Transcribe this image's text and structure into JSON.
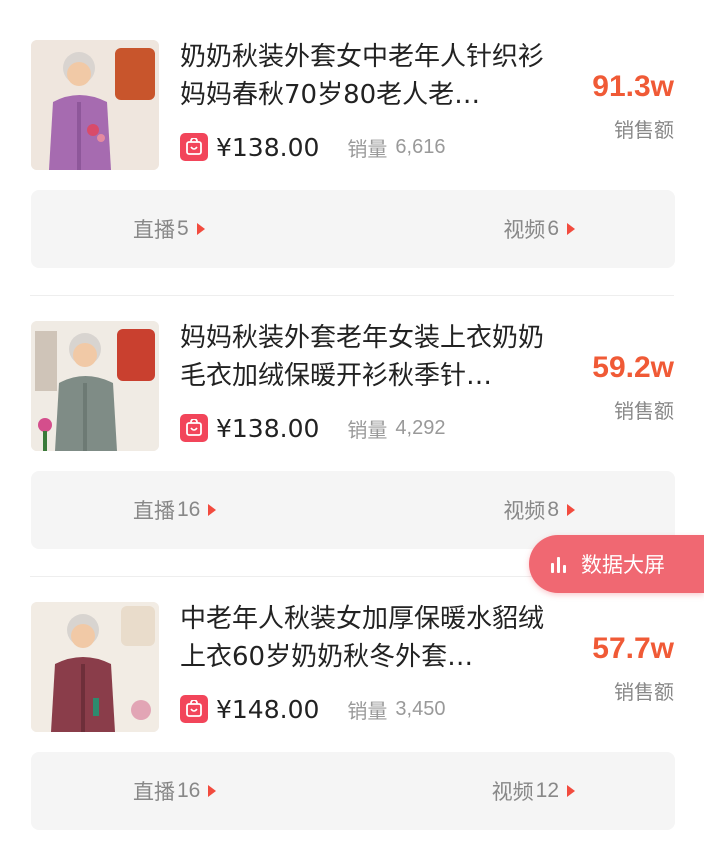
{
  "products": [
    {
      "title": "奶奶秋装外套女中老年人针织衫妈妈春秋70岁80老人老…",
      "price": "¥138.00",
      "sales_label": "销量",
      "sales_value": "6,616",
      "revenue": "91.3w",
      "revenue_label": "销售额",
      "live_label": "直播",
      "live_count": "5",
      "video_label": "视频",
      "video_count": "6",
      "cardigan_color": "#a66bb0"
    },
    {
      "title": "妈妈秋装外套老年女装上衣奶奶毛衣加绒保暖开衫秋季针…",
      "price": "¥138.00",
      "sales_label": "销量",
      "sales_value": "4,292",
      "revenue": "59.2w",
      "revenue_label": "销售额",
      "live_label": "直播",
      "live_count": "16",
      "video_label": "视频",
      "video_count": "8",
      "cardigan_color": "#7f8c86"
    },
    {
      "title": "中老年人秋装女加厚保暖水貂绒上衣60岁奶奶秋冬外套…",
      "price": "¥148.00",
      "sales_label": "销量",
      "sales_value": "3,450",
      "revenue": "57.7w",
      "revenue_label": "销售额",
      "live_label": "直播",
      "live_count": "16",
      "video_label": "视频",
      "video_count": "12",
      "cardigan_color": "#8a3d4a"
    }
  ],
  "floating_button": {
    "label": "数据大屏",
    "icon": "bar-chart-icon"
  },
  "colors": {
    "accent": "#f05a36",
    "shop_badge": "#f2455a",
    "floating": "#f06872"
  }
}
